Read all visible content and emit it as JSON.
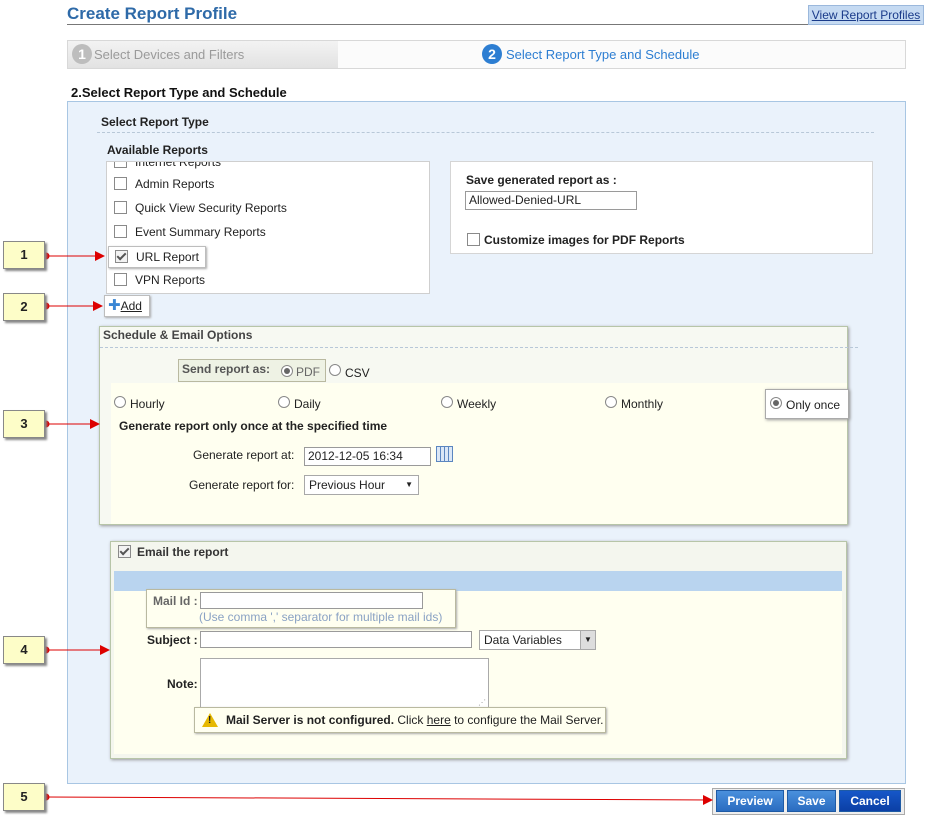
{
  "header": {
    "title": "Create Report Profile",
    "view_link": "View Report Profiles"
  },
  "wizard": {
    "steps": [
      {
        "num": "1",
        "label": "Select Devices and Filters"
      },
      {
        "num": "2",
        "label": "Select Report Type and Schedule"
      }
    ]
  },
  "section_title": "2.Select Report Type and Schedule",
  "report_type": {
    "heading": "Select Report Type",
    "available_label": "Available Reports",
    "items": [
      {
        "label": "Internet Reports",
        "checked": false
      },
      {
        "label": "Admin Reports",
        "checked": false
      },
      {
        "label": "Quick View Security Reports",
        "checked": false
      },
      {
        "label": "Event Summary Reports",
        "checked": false
      },
      {
        "label": "URL Report",
        "checked": true
      },
      {
        "label": "VPN Reports",
        "checked": false
      }
    ],
    "add_label": "Add",
    "save_as_label": "Save generated report as :",
    "save_as_value": "Allowed-Denied-URL",
    "customize_label": "Customize images for PDF Reports"
  },
  "schedule": {
    "heading": "Schedule & Email Options",
    "send_as_label": "Send report as:",
    "formats": [
      "PDF",
      "CSV"
    ],
    "selected_format": "PDF",
    "frequencies": [
      "Hourly",
      "Daily",
      "Weekly",
      "Monthly",
      "Only once"
    ],
    "selected_frequency": "Only once",
    "description": "Generate report only once at the specified time",
    "generate_at_label": "Generate report at:",
    "generate_at_value": "2012-12-05 16:34",
    "generate_for_label": "Generate report for:",
    "generate_for_value": "Previous Hour"
  },
  "email": {
    "checkbox_label": "Email the report",
    "mail_id_label": "Mail Id :",
    "mail_id_value": "",
    "mail_hint": "(Use comma ',' separator for multiple mail ids)",
    "subject_label": "Subject :",
    "subject_value": "",
    "data_variables": "Data Variables",
    "note_label": "Note:",
    "warning_bold": "Mail Server is not configured.",
    "warning_pre": " Click ",
    "warning_link": "here",
    "warning_post": " to configure the Mail Server."
  },
  "buttons": {
    "preview": "Preview",
    "save": "Save",
    "cancel": "Cancel"
  },
  "callouts": [
    "1",
    "2",
    "3",
    "4",
    "5"
  ],
  "colors": {
    "accent": "#2e6aa8",
    "callout_arrow": "#dd0000",
    "button_blue": "#2a6cc0"
  }
}
